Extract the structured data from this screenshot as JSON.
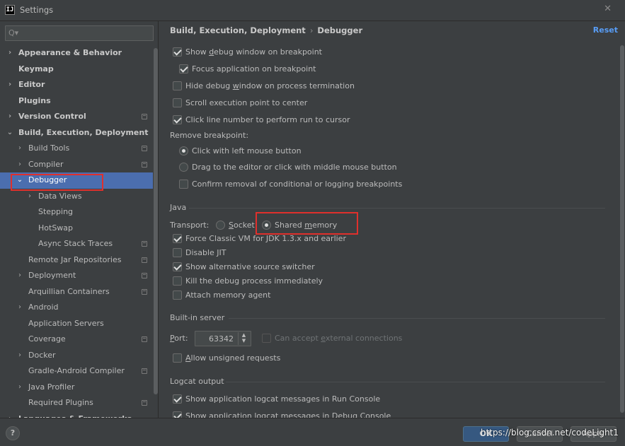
{
  "window": {
    "title": "Settings",
    "close_glyph": "✕",
    "app_icon": "IJ"
  },
  "sidebar": {
    "search_placeholder": "",
    "search_glyph": "Q▾",
    "items": [
      {
        "label": "Appearance & Behavior",
        "indent": 0,
        "arrow": "›",
        "bold": true,
        "proj": false
      },
      {
        "label": "Keymap",
        "indent": 0,
        "arrow": "",
        "bold": true,
        "proj": false
      },
      {
        "label": "Editor",
        "indent": 0,
        "arrow": "›",
        "bold": true,
        "proj": false
      },
      {
        "label": "Plugins",
        "indent": 0,
        "arrow": "",
        "bold": true,
        "proj": false
      },
      {
        "label": "Version Control",
        "indent": 0,
        "arrow": "›",
        "bold": true,
        "proj": true
      },
      {
        "label": "Build, Execution, Deployment",
        "indent": 0,
        "arrow": "⌄",
        "bold": true,
        "proj": false
      },
      {
        "label": "Build Tools",
        "indent": 1,
        "arrow": "›",
        "bold": false,
        "proj": true
      },
      {
        "label": "Compiler",
        "indent": 1,
        "arrow": "›",
        "bold": false,
        "proj": true
      },
      {
        "label": "Debugger",
        "indent": 1,
        "arrow": "⌄",
        "bold": false,
        "proj": false,
        "selected": true
      },
      {
        "label": "Data Views",
        "indent": 2,
        "arrow": "›",
        "bold": false,
        "proj": false
      },
      {
        "label": "Stepping",
        "indent": 2,
        "arrow": "",
        "bold": false,
        "proj": false
      },
      {
        "label": "HotSwap",
        "indent": 2,
        "arrow": "",
        "bold": false,
        "proj": false
      },
      {
        "label": "Async Stack Traces",
        "indent": 2,
        "arrow": "",
        "bold": false,
        "proj": true
      },
      {
        "label": "Remote Jar Repositories",
        "indent": 1,
        "arrow": "",
        "bold": false,
        "proj": true
      },
      {
        "label": "Deployment",
        "indent": 1,
        "arrow": "›",
        "bold": false,
        "proj": true
      },
      {
        "label": "Arquillian Containers",
        "indent": 1,
        "arrow": "",
        "bold": false,
        "proj": true
      },
      {
        "label": "Android",
        "indent": 1,
        "arrow": "›",
        "bold": false,
        "proj": false
      },
      {
        "label": "Application Servers",
        "indent": 1,
        "arrow": "",
        "bold": false,
        "proj": false
      },
      {
        "label": "Coverage",
        "indent": 1,
        "arrow": "",
        "bold": false,
        "proj": true
      },
      {
        "label": "Docker",
        "indent": 1,
        "arrow": "›",
        "bold": false,
        "proj": false
      },
      {
        "label": "Gradle-Android Compiler",
        "indent": 1,
        "arrow": "",
        "bold": false,
        "proj": true
      },
      {
        "label": "Java Profiler",
        "indent": 1,
        "arrow": "›",
        "bold": false,
        "proj": false
      },
      {
        "label": "Required Plugins",
        "indent": 1,
        "arrow": "",
        "bold": false,
        "proj": true
      },
      {
        "label": "Languages & Frameworks",
        "indent": 0,
        "arrow": "›",
        "bold": true,
        "proj": false
      }
    ]
  },
  "breadcrumb": {
    "parent": "Build, Execution, Deployment",
    "separator": "›",
    "current": "Debugger",
    "reset": "Reset"
  },
  "general": {
    "show_debug_window": {
      "pre": "Show ",
      "u": "d",
      "post": "ebug window on breakpoint",
      "checked": true
    },
    "focus_app": {
      "pre": "Focus application on breakpoint",
      "u": "",
      "post": "",
      "checked": true
    },
    "hide_debug_window": {
      "pre": "Hide debug ",
      "u": "w",
      "post": "indow on process termination",
      "checked": false
    },
    "scroll_exec": {
      "pre": "Scroll execution point to center",
      "u": "",
      "post": "",
      "checked": false
    },
    "click_line": {
      "pre": "Click line number to perform run to cursor",
      "u": "",
      "post": "",
      "checked": true
    },
    "remove_bp_label": "Remove breakpoint:",
    "remove_left": {
      "label": "Click with left mouse button",
      "selected": true
    },
    "remove_drag": {
      "label": "Drag to the editor or click with middle mouse button",
      "selected": false
    },
    "confirm_removal": {
      "label": "Confirm removal of conditional or logging breakpoints",
      "checked": false
    }
  },
  "java": {
    "section": "Java",
    "transport_label": "Transport:",
    "socket": {
      "pre": "",
      "u": "S",
      "post": "ocket",
      "selected": false
    },
    "shared_memory": {
      "pre": "Shared ",
      "u": "m",
      "post": "emory",
      "selected": true
    },
    "force_classic": {
      "label": "Force Classic VM for JDK 1.3.x and earlier",
      "checked": true
    },
    "disable_jit": {
      "label": "Disable JIT",
      "checked": false
    },
    "alt_source": {
      "label": "Show alternative source switcher",
      "checked": true
    },
    "kill_debug": {
      "label": "Kill the debug process immediately",
      "checked": false
    },
    "attach_agent": {
      "label": "Attach memory agent",
      "checked": false
    }
  },
  "builtin_server": {
    "section": "Built-in server",
    "port_label_pre": "",
    "port_label_u": "P",
    "port_label_post": "ort:",
    "port_value": "63342",
    "spin_up": "▲",
    "spin_down": "▼",
    "external": {
      "pre": "Can accept ",
      "u": "e",
      "post": "xternal connections",
      "checked": false,
      "disabled": true
    },
    "unsigned": {
      "pre": "",
      "u": "A",
      "post": "llow unsigned requests",
      "checked": false
    }
  },
  "logcat": {
    "section": "Logcat output",
    "run_console": {
      "label": "Show application logcat messages in Run Console",
      "checked": true
    },
    "debug_console": {
      "label": "Show application logcat messages in Debug Console",
      "checked": true
    }
  },
  "buttons": {
    "help": "?",
    "ok": "OK",
    "cancel": "Cancel",
    "apply": "Apply"
  },
  "watermark": "https://blog.csdn.net/codeLight1",
  "colors": {
    "selection": "#4b6eaf",
    "highlight_box": "#e0302c",
    "link": "#589df6",
    "background": "#3c3f41"
  }
}
